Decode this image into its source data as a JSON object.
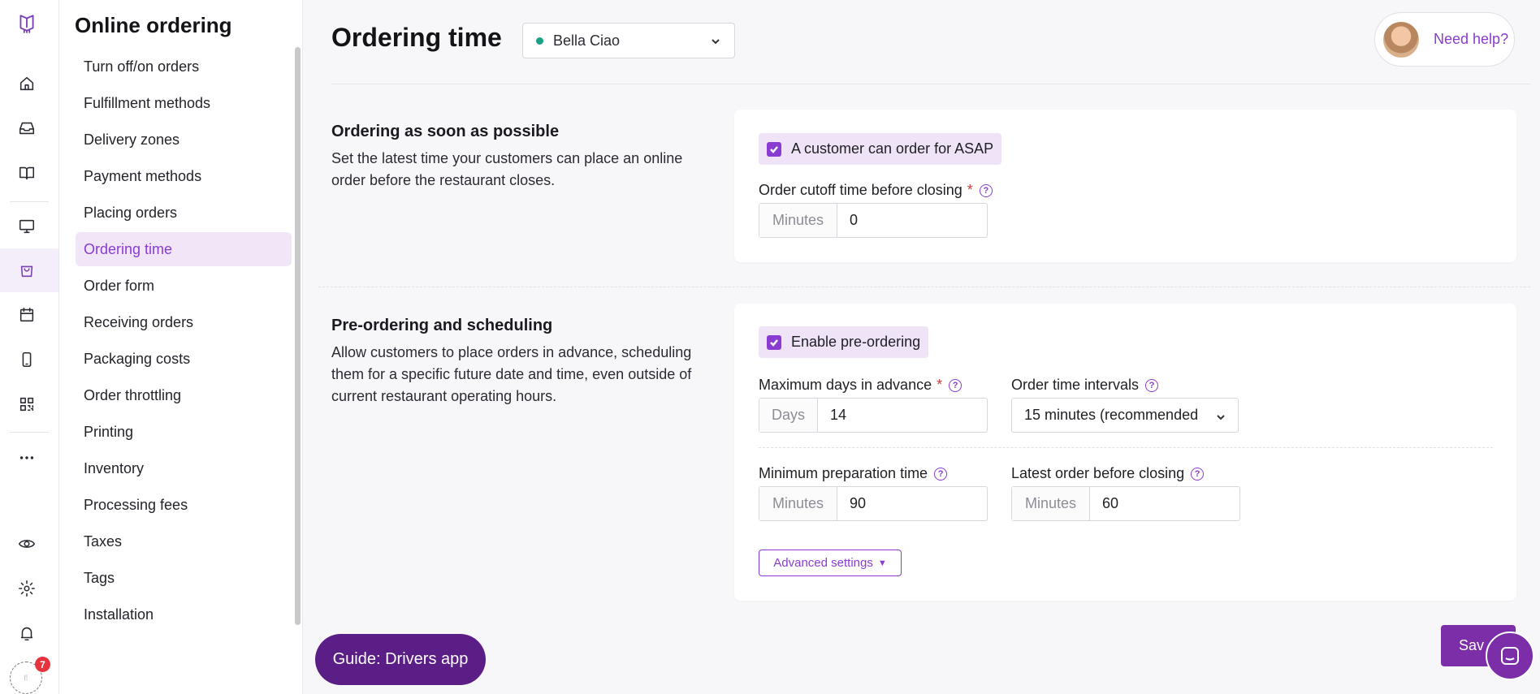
{
  "app": {
    "accent": "#8a3bd0",
    "badge_count": "7"
  },
  "sidebar": {
    "title": "Online ordering",
    "items": [
      {
        "label": "Turn off/on orders"
      },
      {
        "label": "Fulfillment methods"
      },
      {
        "label": "Delivery zones"
      },
      {
        "label": "Payment methods"
      },
      {
        "label": "Placing orders"
      },
      {
        "label": "Ordering time",
        "active": true
      },
      {
        "label": "Order form"
      },
      {
        "label": "Receiving orders"
      },
      {
        "label": "Packaging costs"
      },
      {
        "label": "Order throttling"
      },
      {
        "label": "Printing"
      },
      {
        "label": "Inventory"
      },
      {
        "label": "Processing fees"
      },
      {
        "label": "Taxes"
      },
      {
        "label": "Tags"
      },
      {
        "label": "Installation"
      }
    ]
  },
  "header": {
    "title": "Ordering time",
    "location": "Bella Ciao",
    "help_label": "Need help?"
  },
  "asap": {
    "title": "Ordering as soon as possible",
    "description": "Set the latest time your customers can place an online order before the restaurant closes.",
    "checkbox_label": "A customer can order for ASAP",
    "cutoff_label": "Order cutoff time before closing",
    "cutoff_unit": "Minutes",
    "cutoff_value": "0"
  },
  "preorder": {
    "title": "Pre-ordering and scheduling",
    "description": "Allow customers to place orders in advance, scheduling them for a specific future date and time, even outside of current restaurant operating hours.",
    "checkbox_label": "Enable pre-ordering",
    "max_days_label": "Maximum days in advance",
    "max_days_unit": "Days",
    "max_days_value": "14",
    "interval_label": "Order time intervals",
    "interval_value": "15 minutes (recommended",
    "min_prep_label": "Minimum preparation time",
    "min_prep_unit": "Minutes",
    "min_prep_value": "90",
    "latest_label": "Latest order before closing",
    "latest_unit": "Minutes",
    "latest_value": "60",
    "advanced_label": "Advanced settings"
  },
  "footer": {
    "guide_label": "Guide: Drivers app",
    "save_label": "Sav"
  }
}
